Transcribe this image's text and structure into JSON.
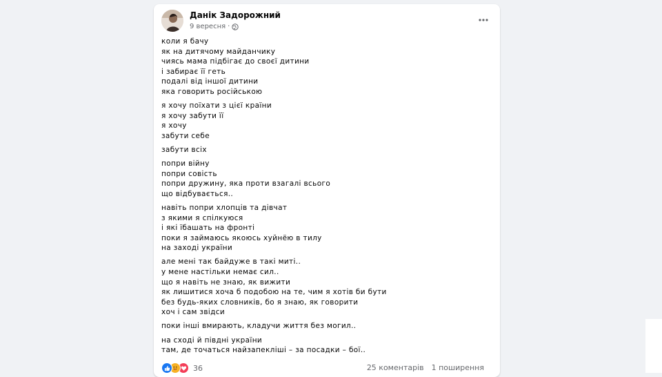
{
  "post": {
    "author": "Данік Задорожний",
    "date": "9 вересня",
    "separator": "·",
    "privacy_icon": "globe-icon",
    "menu_icon": "more-options-icon"
  },
  "stanzas": [
    [
      "коли я бачу",
      "як на дитячому майданчику",
      "чиясь мама підбігає до своєї дитини",
      "і забирає її геть",
      "подалі від іншої дитини",
      "яка говорить російською"
    ],
    [
      "я хочу поїхати з цієї країни",
      "я хочу забути її",
      "я хочу",
      "забути себе"
    ],
    [
      "забути всіх"
    ],
    [
      "попри війну",
      "попри совість",
      "попри дружину, яка проти взагалі всього",
      "що відбувається.."
    ],
    [
      "навіть попри хлопців та дівчат",
      "з якими я спілкуюся",
      "і які їбашать на фронті",
      "поки я займаюсь якоюсь хуйнёю в тилу",
      "на заході україни"
    ],
    [
      "але мені так байдуже в такі миті..",
      "у мене настільки немає сил..",
      "що я навіть не знаю, як вижити",
      "як лишитися хоча б подобою на те, чим я хотів би бути",
      "без будь-яких словників, бо я знаю, як говорити",
      "хоч і сам звідси"
    ],
    [
      "поки інші вмирають, кладучи життя без могил.."
    ],
    [
      "на сході й півдні україни",
      "там, де точаться найзапекліші – за посадки – бої.."
    ]
  ],
  "footer": {
    "reaction_icons": [
      "like-icon",
      "care-icon",
      "love-icon"
    ],
    "reaction_count": "36",
    "comments": "25 коментарів",
    "shares": "1 поширення"
  },
  "colors": {
    "page_background": "#f0f2f5",
    "card_background": "#ffffff",
    "text": "#050505",
    "secondary_text": "#65676b",
    "like": "#1877f2",
    "care": "#f7b125",
    "love": "#f33e58"
  }
}
